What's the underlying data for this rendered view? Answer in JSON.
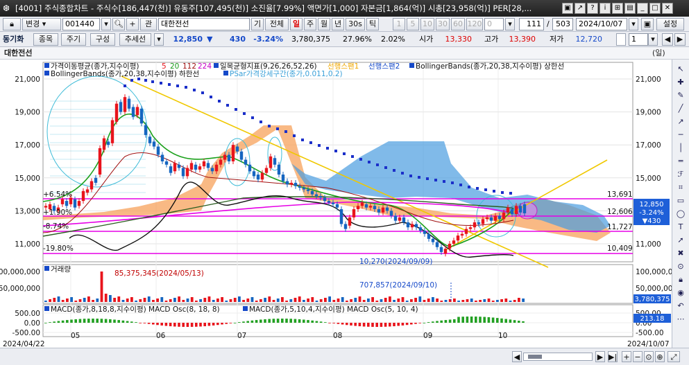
{
  "window": {
    "title": "[4001] 주식종합차트 - 주식수[186,447(천)] 유동주[107,495(천)] 소진율[7.99%] 액면가[1,000] 자본금[1,864(억)] 시총[23,958(억)] PER[28,...",
    "logo": "❆"
  },
  "toolbar": {
    "mode": "변경",
    "code": "001440",
    "gwan": "관",
    "name": "대한전선",
    "gi": "기",
    "jeonche": "전체",
    "il": "일",
    "ju": "주",
    "wol": "월",
    "nyeon": "년",
    "sec30": "30s",
    "tik": "틱",
    "nums": [
      "1",
      "5",
      "10",
      "30",
      "60",
      "120"
    ],
    "zero": "0",
    "count": "111",
    "total": "503",
    "date": "2024/10/07",
    "settings": "설정"
  },
  "toolbar2": {
    "sync": "동기화",
    "jongmok": "종목",
    "jugi": "주기",
    "gusung": "구성",
    "chuse": "추세선",
    "price": "12,850",
    "change": "430",
    "rate": "-3.24%",
    "volume": "3,780,375",
    "turnover": "27.96%",
    "pct2": "2.02%",
    "open_label": "시가",
    "open": "13,330",
    "high_label": "고가",
    "high": "13,390",
    "low_label": "저가",
    "low": "12,720",
    "count_sel": "1"
  },
  "namerow": {
    "name": "대한전선",
    "unit": "(일)"
  },
  "legend": {
    "ma": "가격이동평균(종가,지수이평)",
    "ma_vals": [
      "5",
      "20",
      "112",
      "224"
    ],
    "ichimoku": "일목균형지표(9,26,26,52,26)",
    "span1": "선행스팬1",
    "span2": "선행스팬2",
    "bb_upper": "BollingerBands(종가,20,38,지수이평) 상한선",
    "bb_lower": "BollingerBands(종가,20,38,지수이평) 하한선",
    "psar": "PSar가격강세구간(종가,0.011,0.2)",
    "volume": "거래량",
    "macd1": "MACD(종가,8,18,8,지수이평) MACD Osc(8, 18, 8)",
    "macd2": "MACD(종가,5,10,4,지수이평) MACD Osc(5, 10, 4)"
  },
  "annotations": {
    "pct1": "+6.54%",
    "pct2": "+1.90%",
    "pct3": "-8.74%",
    "pct4": "-19.80%",
    "low_note": "10,270(2024/09/09)",
    "vol_note": "85,375,345(2024/05/13)",
    "vol_note2": "707,857(2024/09/10)",
    "lvl1": "13,691",
    "lvl2": "12,606",
    "lvl3": "11,727",
    "lvl4": "10,409",
    "cur_price": "12,850",
    "cur_rate": "-3.24%",
    "cur_change": "▼430",
    "vol_cur": "3,780,375",
    "macd_cur": "213.18"
  },
  "axes": {
    "price_ticks": [
      "21,000",
      "19,000",
      "17,000",
      "15,000",
      "13,000",
      "11,000"
    ],
    "vol_ticks": [
      "100,000,000",
      "50,000,000"
    ],
    "macd_ticks": [
      "500.00",
      "0.00",
      "-500.00"
    ],
    "macd_ticks_right": [
      "500.00",
      "0.00",
      "-500.00"
    ],
    "date_start": "2024/04/22",
    "date_end": "2024/10/07",
    "months": [
      "05",
      "06",
      "07",
      "08",
      "09",
      "10"
    ]
  },
  "colors": {
    "up": "#e8141c",
    "down": "#1565c0",
    "ichimoku_up": "#f7a25b",
    "ichimoku_down": "#4a9ce0",
    "psar": "#1b2fc9",
    "magenta": "#e600e6",
    "trend": "#f0c800"
  },
  "toolbox_icons": [
    "cursor-icon",
    "crosshair-icon",
    "pencil-icon",
    "trend-line-icon",
    "ray-icon",
    "horizontal-line-icon",
    "vertical-line-icon",
    "channel-icon",
    "fibonacci-icon",
    "gann-icon",
    "rectangle-icon",
    "ellipse-icon",
    "text-icon",
    "arrow-icon",
    "delete-icon",
    "magnet-icon",
    "lock-icon",
    "eye-icon",
    "undo-icon",
    "more-icon"
  ]
}
